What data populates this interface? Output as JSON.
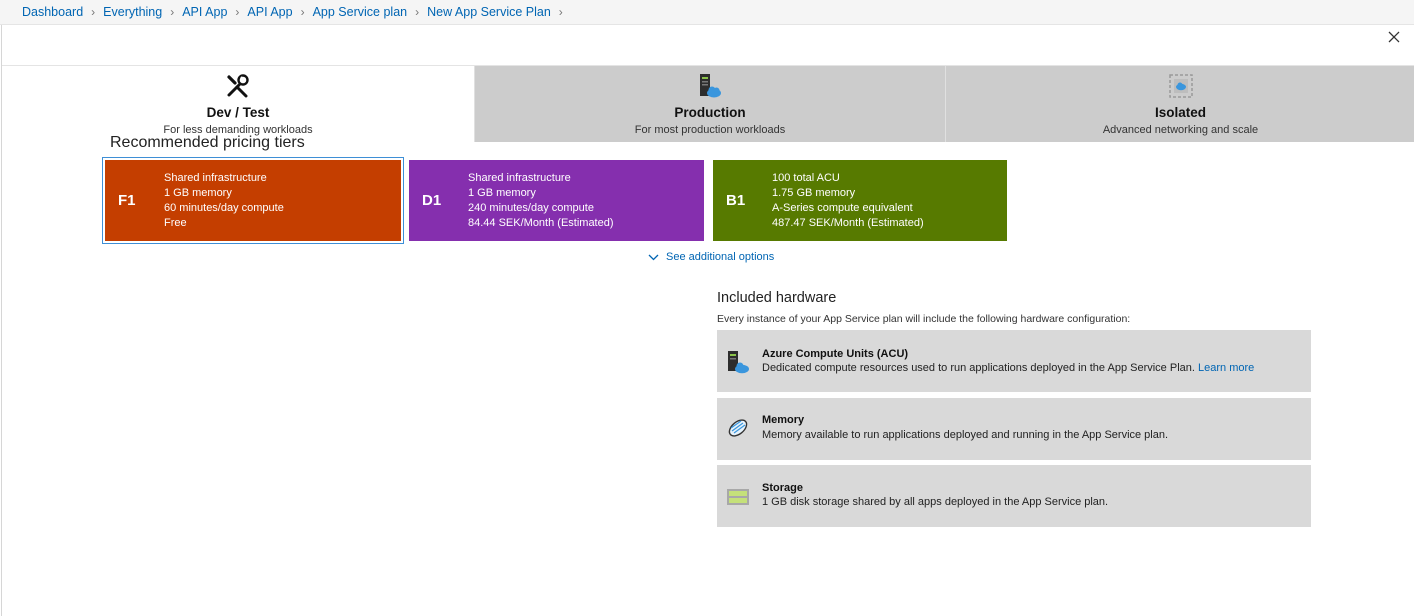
{
  "breadcrumb": [
    "Dashboard",
    "Everything",
    "API App",
    "API App",
    "App Service plan",
    "New App Service Plan"
  ],
  "tabs": [
    {
      "icon": "tools-icon",
      "title": "Dev / Test",
      "subtitle": "For less demanding workloads",
      "active": true
    },
    {
      "icon": "server-cloud-icon",
      "title": "Production",
      "subtitle": "For most production workloads",
      "active": false
    },
    {
      "icon": "isolated-network-icon",
      "title": "Isolated",
      "subtitle": "Advanced networking and scale",
      "active": false
    }
  ],
  "recommended": {
    "heading": "Recommended pricing tiers",
    "tiers": [
      {
        "code": "F1",
        "color": "#c43e00",
        "lines": [
          "Shared infrastructure",
          "1 GB memory",
          "60 minutes/day compute",
          "Free"
        ],
        "selected": true
      },
      {
        "code": "D1",
        "color": "#852fae",
        "lines": [
          "Shared infrastructure",
          "1 GB memory",
          "240 minutes/day compute",
          "84.44 SEK/Month (Estimated)"
        ],
        "selected": false
      },
      {
        "code": "B1",
        "color": "#577a00",
        "lines": [
          "100 total ACU",
          "1.75 GB memory",
          "A-Series compute equivalent",
          "487.47 SEK/Month (Estimated)"
        ],
        "selected": false
      }
    ],
    "see_more": "See additional options"
  },
  "hardware": {
    "heading": "Included hardware",
    "subtitle": "Every instance of your App Service plan will include the following hardware configuration:",
    "items": [
      {
        "icon": "server-cloud-icon",
        "title": "Azure Compute Units (ACU)",
        "desc": "Dedicated compute resources used to run applications deployed in the App Service Plan.",
        "link": "Learn more"
      },
      {
        "icon": "memory-icon",
        "title": "Memory",
        "desc": "Memory available to run applications deployed and running in the App Service plan."
      },
      {
        "icon": "storage-icon",
        "title": "Storage",
        "desc": "1 GB disk storage shared by all apps deployed in the App Service plan."
      }
    ]
  },
  "colors": {
    "link": "#0065b3",
    "inactive_tab": "#cccccc",
    "card": "#d9d9d9",
    "focus": "#3e8fd6"
  }
}
